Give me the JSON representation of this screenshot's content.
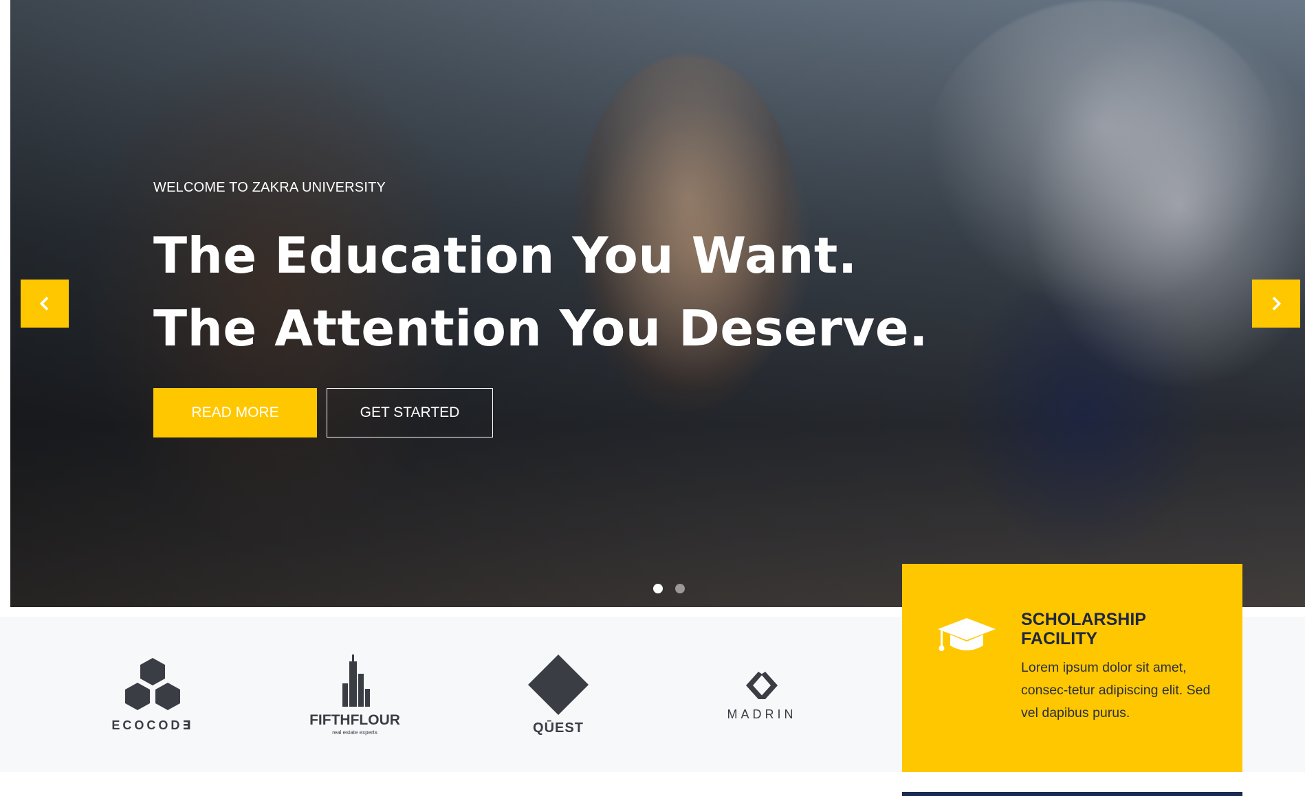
{
  "hero": {
    "eyebrow": "WELCOME TO ZAKRA UNIVERSITY",
    "headline_line1": "The Education You Want.",
    "headline_line2": "The Attention You Deserve.",
    "buttons": {
      "read_more": "READ MORE",
      "get_started": "GET STARTED"
    },
    "slider": {
      "prev_icon": "chevron-left-icon",
      "next_icon": "chevron-right-icon",
      "slide_count": 2,
      "active_slide": 1
    }
  },
  "logos": [
    {
      "name": "ECOCOD∃",
      "icon": "hexagon-cluster-logo"
    },
    {
      "name": "FIFTHFLOUR",
      "sub": "real estate experts",
      "icon": "skyscraper-logo"
    },
    {
      "name": "QŪEST",
      "icon": "diamond-logo"
    },
    {
      "name": "MADRIN",
      "icon": "interlocking-chevrons-logo"
    }
  ],
  "feature": {
    "icon": "graduation-cap-icon",
    "title_line1": "SCHOLARSHIP",
    "title_line2": "FACILITY",
    "text": "Lorem ipsum dolor sit amet, consec-tetur adipiscing elit. Sed vel dapibus purus."
  },
  "colors": {
    "accent": "#ffc700",
    "navy": "#1a2a52",
    "logo_gray": "#3a3d44",
    "strip_bg": "#f7f8fa"
  }
}
